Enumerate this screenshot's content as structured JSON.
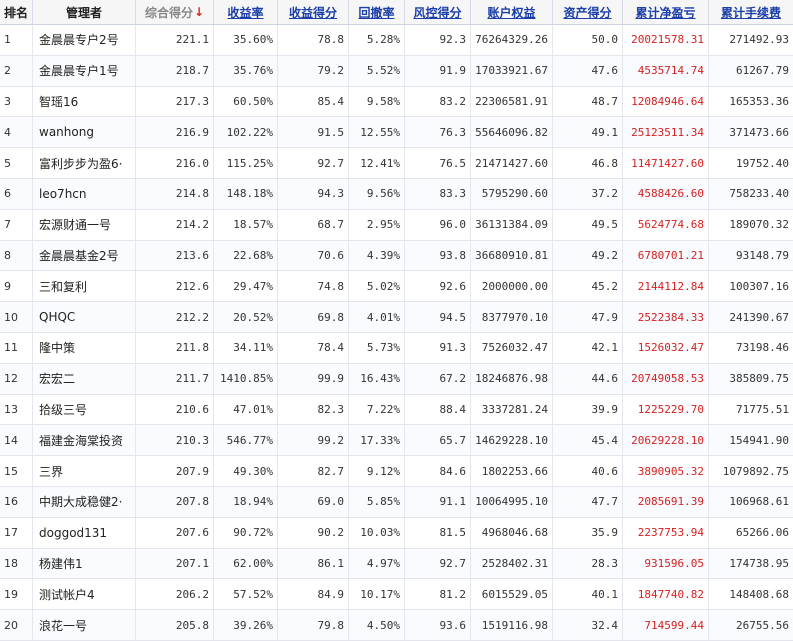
{
  "headers": [
    "排名",
    "管理者",
    "综合得分",
    "收益率",
    "收益得分",
    "回撤率",
    "风控得分",
    "账户权益",
    "资产得分",
    "累计净盈亏",
    "累计手续费"
  ],
  "sort_arrow": "↓",
  "rows": [
    [
      "1",
      "金晨晨专户2号",
      "221.1",
      "35.60%",
      "78.8",
      "5.28%",
      "92.3",
      "76264329.26",
      "50.0",
      "20021578.31",
      "271492.93"
    ],
    [
      "2",
      "金晨晨专户1号",
      "218.7",
      "35.76%",
      "79.2",
      "5.52%",
      "91.9",
      "17033921.67",
      "47.6",
      "4535714.74",
      "61267.79"
    ],
    [
      "3",
      "智瑶16",
      "217.3",
      "60.50%",
      "85.4",
      "9.58%",
      "83.2",
      "22306581.91",
      "48.7",
      "12084946.64",
      "165353.36"
    ],
    [
      "4",
      "wanhong",
      "216.9",
      "102.22%",
      "91.5",
      "12.55%",
      "76.3",
      "55646096.82",
      "49.1",
      "25123511.34",
      "371473.66"
    ],
    [
      "5",
      "富利步步为盈6·",
      "216.0",
      "115.25%",
      "92.7",
      "12.41%",
      "76.5",
      "21471427.60",
      "46.8",
      "11471427.60",
      "19752.40"
    ],
    [
      "6",
      "leo7hcn",
      "214.8",
      "148.18%",
      "94.3",
      "9.56%",
      "83.3",
      "5795290.60",
      "37.2",
      "4588426.60",
      "758233.40"
    ],
    [
      "7",
      "宏源财通一号",
      "214.2",
      "18.57%",
      "68.7",
      "2.95%",
      "96.0",
      "36131384.09",
      "49.5",
      "5624774.68",
      "189070.32"
    ],
    [
      "8",
      "金晨晨基金2号",
      "213.6",
      "22.68%",
      "70.6",
      "4.39%",
      "93.8",
      "36680910.81",
      "49.2",
      "6780701.21",
      "93148.79"
    ],
    [
      "9",
      "三和复利",
      "212.6",
      "29.47%",
      "74.8",
      "5.02%",
      "92.6",
      "2000000.00",
      "45.2",
      "2144112.84",
      "100307.16"
    ],
    [
      "10",
      "QHQC",
      "212.2",
      "20.52%",
      "69.8",
      "4.01%",
      "94.5",
      "8377970.10",
      "47.9",
      "2522384.33",
      "241390.67"
    ],
    [
      "11",
      "隆中策",
      "211.8",
      "34.11%",
      "78.4",
      "5.73%",
      "91.3",
      "7526032.47",
      "42.1",
      "1526032.47",
      "73198.46"
    ],
    [
      "12",
      "宏宏二",
      "211.7",
      "1410.85%",
      "99.9",
      "16.43%",
      "67.2",
      "18246876.98",
      "44.6",
      "20749058.53",
      "385809.75"
    ],
    [
      "13",
      "拾级三号",
      "210.6",
      "47.01%",
      "82.3",
      "7.22%",
      "88.4",
      "3337281.24",
      "39.9",
      "1225229.70",
      "71775.51"
    ],
    [
      "14",
      "福建金海棠投资",
      "210.3",
      "546.77%",
      "99.2",
      "17.33%",
      "65.7",
      "14629228.10",
      "45.4",
      "20629228.10",
      "154941.90"
    ],
    [
      "15",
      "三界",
      "207.9",
      "49.30%",
      "82.7",
      "9.12%",
      "84.6",
      "1802253.66",
      "40.6",
      "3890905.32",
      "1079892.75"
    ],
    [
      "16",
      "中期大成稳健2·",
      "207.8",
      "18.94%",
      "69.0",
      "5.85%",
      "91.1",
      "10064995.10",
      "47.7",
      "2085691.39",
      "106968.61"
    ],
    [
      "17",
      "doggod131",
      "207.6",
      "90.72%",
      "90.2",
      "10.03%",
      "81.5",
      "4968046.68",
      "35.9",
      "2237753.94",
      "65266.06"
    ],
    [
      "18",
      "杨建伟1",
      "207.1",
      "62.00%",
      "86.1",
      "4.97%",
      "92.7",
      "2528402.31",
      "28.3",
      "931596.05",
      "174738.95"
    ],
    [
      "19",
      "测试帐户4",
      "206.2",
      "57.52%",
      "84.9",
      "10.17%",
      "81.2",
      "6015529.05",
      "40.1",
      "1847740.82",
      "148408.68"
    ],
    [
      "20",
      "浪花一号",
      "205.8",
      "39.26%",
      "79.8",
      "4.50%",
      "93.6",
      "1519116.98",
      "32.4",
      "714599.44",
      "26755.56"
    ]
  ]
}
